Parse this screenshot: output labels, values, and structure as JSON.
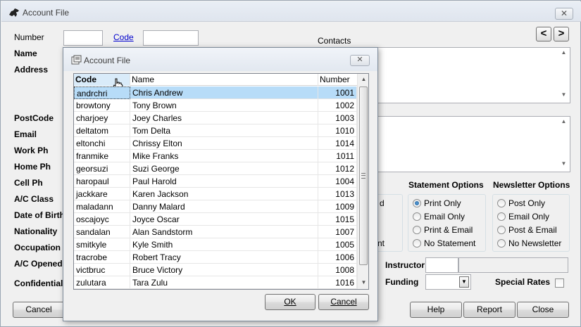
{
  "window": {
    "title": "Account File"
  },
  "form": {
    "number_label": "Number",
    "code_link": "Code",
    "contacts_label": "Contacts",
    "labels": [
      "Name",
      "Address",
      "PostCode",
      "Email",
      "Work Ph",
      "Home Ph",
      "Cell Ph",
      "A/C Class",
      "Date of Birth",
      "Nationality",
      "Occupation",
      "A/C Opened",
      "Confidential"
    ],
    "statement_options": {
      "title": "Statement Options",
      "options": [
        {
          "label": "Print Only",
          "selected": true
        },
        {
          "label": "Email Only",
          "selected": false
        },
        {
          "label": "Print & Email",
          "selected": false
        },
        {
          "label": "No Statement",
          "selected": false
        }
      ]
    },
    "newsletter_options": {
      "title": "Newsletter Options",
      "options": [
        {
          "label": "Post Only",
          "selected": false
        },
        {
          "label": "Email Only",
          "selected": false
        },
        {
          "label": "Post & Email",
          "selected": false
        },
        {
          "label": "No Newsletter",
          "selected": false
        }
      ]
    },
    "partial_group_text": [
      "d",
      "nt"
    ],
    "instructor_label": "Instructor",
    "funding_label": "Funding",
    "special_rates_label": "Special Rates",
    "buttons": {
      "cancel": "Cancel",
      "help": "Help",
      "report": "Report",
      "close": "Close"
    }
  },
  "dialog": {
    "title": "Account File",
    "columns": [
      "Code",
      "Name",
      "Number"
    ],
    "rows": [
      {
        "code": "andrchri",
        "name": "Chris Andrew",
        "number": "1001",
        "selected": true
      },
      {
        "code": "browtony",
        "name": "Tony Brown",
        "number": "1002"
      },
      {
        "code": "charjoey",
        "name": "Joey Charles",
        "number": "1003"
      },
      {
        "code": "deltatom",
        "name": "Tom Delta",
        "number": "1010"
      },
      {
        "code": "eltonchi",
        "name": "Chrissy Elton",
        "number": "1014"
      },
      {
        "code": "franmike",
        "name": "Mike Franks",
        "number": "1011"
      },
      {
        "code": "georsuzi",
        "name": "Suzi George",
        "number": "1012"
      },
      {
        "code": "haropaul",
        "name": "Paul Harold",
        "number": "1004"
      },
      {
        "code": "jackkare",
        "name": "Karen Jackson",
        "number": "1013"
      },
      {
        "code": "maladann",
        "name": "Danny Malard",
        "number": "1009"
      },
      {
        "code": "oscajoyc",
        "name": "Joyce Oscar",
        "number": "1015"
      },
      {
        "code": "sandalan",
        "name": "Alan Sandstorm",
        "number": "1007"
      },
      {
        "code": "smitkyle",
        "name": "Kyle Smith",
        "number": "1005"
      },
      {
        "code": "tracrobe",
        "name": "Robert Tracy",
        "number": "1006"
      },
      {
        "code": "victbruc",
        "name": "Bruce Victory",
        "number": "1008"
      },
      {
        "code": "zulutara",
        "name": "Tara Zulu",
        "number": "1016"
      }
    ],
    "ok_label": "OK",
    "cancel_label": "Cancel"
  }
}
